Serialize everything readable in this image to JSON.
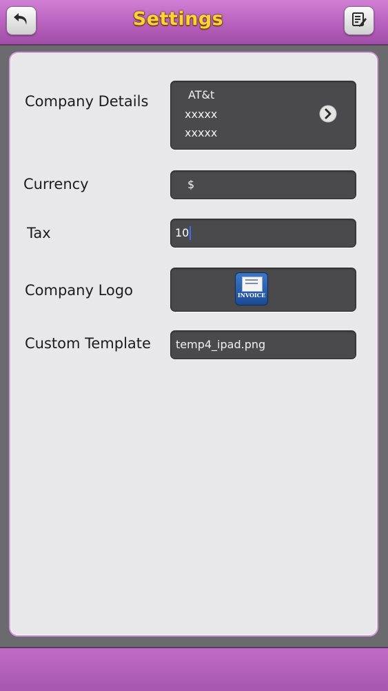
{
  "header": {
    "title": "Settings",
    "back_icon": "back-arrow-icon",
    "right_icon": "edit-notes-icon"
  },
  "form": {
    "company_details": {
      "label": "Company Details",
      "lines": [
        "AT&t",
        "xxxxx",
        "xxxxx"
      ],
      "disclosure_icon": "chevron-right-circle-icon"
    },
    "currency": {
      "label": "Currency",
      "value": "$"
    },
    "tax": {
      "label": "Tax",
      "value": "10"
    },
    "company_logo": {
      "label": "Company Logo",
      "logo_text": "INVOICE",
      "logo_icon": "invoice-app-logo-icon"
    },
    "custom_template": {
      "label": "Custom Template",
      "value": "temp4_ipad.png"
    }
  },
  "colors": {
    "bar": "#b760bd",
    "title": "#ffd23a",
    "field_bg": "#4a4a4c",
    "panel_bg": "#e8e7ea"
  }
}
